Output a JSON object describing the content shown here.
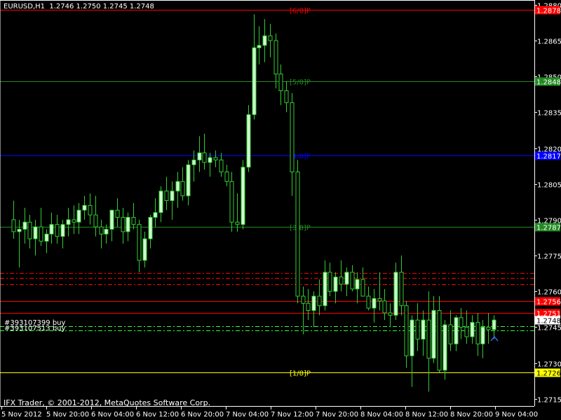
{
  "header": {
    "symbol_tf": "EURUSD,H1",
    "ohlc": "1.2746 1.2750 1.2745 1.2748"
  },
  "footer": {
    "copyright": "IFX Trader, © 2001-2012, MetaQuotes Software Corp."
  },
  "orders": [
    {
      "label": "#393107399 buy",
      "price": 1.27458
    },
    {
      "label": "#393107513 buy",
      "price": 1.27438
    }
  ],
  "colors": {
    "background": "#000000",
    "axis": "#ffffff",
    "candle_bull": "#ccffcc",
    "candle_bear": "#000000",
    "wick": "#33cc33",
    "murrey_red": "#ff0000",
    "murrey_green": "#228b22",
    "murrey_blue": "#0000ff",
    "murrey_yellow": "#ffff00",
    "dashed_red": "#ff0000",
    "dashed_green": "#33ff33"
  },
  "chart_data": {
    "type": "candlestick",
    "symbol": "EURUSD",
    "timeframe": "H1",
    "ylim": [
      1.2712,
      1.2882
    ],
    "y_ticks": [
      "1.2880",
      "1.2865",
      "1.2850",
      "1.2835",
      "1.2820",
      "1.2805",
      "1.2790",
      "1.2775",
      "1.2760",
      "1.2745",
      "1.2730",
      "1.2715"
    ],
    "x_ticks": [
      "5 Nov 2012",
      "5 Nov 20:00",
      "6 Nov 04:00",
      "6 Nov 12:00",
      "6 Nov 20:00",
      "7 Nov 04:00",
      "7 Nov 12:00",
      "7 Nov 20:00",
      "8 Nov 04:00",
      "8 Nov 12:00",
      "8 Nov 20:00",
      "9 Nov 04:00"
    ],
    "current_price": "1.2748",
    "levels": [
      {
        "label": "[6/8]P",
        "price": 1.2878,
        "tag": "1.2878",
        "color": "murrey_red",
        "kind": "line"
      },
      {
        "label": "[5/8]P",
        "price": 1.2848,
        "tag": "1.2848",
        "color": "murrey_green",
        "kind": "line"
      },
      {
        "label": "[4/8]P",
        "price": 1.2817,
        "tag": "1.2817",
        "color": "murrey_blue",
        "kind": "line"
      },
      {
        "label": "[3/8]P",
        "price": 1.2787,
        "tag": "1.2787",
        "color": "murrey_green",
        "kind": "line"
      },
      {
        "label": "",
        "price": 1.2756,
        "tag": "1.2756",
        "color": "murrey_red",
        "kind": "line"
      },
      {
        "label": "",
        "price": 1.2751,
        "tag": "1.2751",
        "color": "murrey_red",
        "kind": "line"
      },
      {
        "label": "[1/8]P",
        "price": 1.2726,
        "tag": "1.2726",
        "color": "murrey_yellow",
        "kind": "line"
      }
    ],
    "dashed_levels": [
      {
        "price": 1.27678,
        "color": "dashed_red"
      },
      {
        "price": 1.27655,
        "color": "dashed_red"
      },
      {
        "price": 1.2763,
        "color": "dashed_red"
      },
      {
        "price": 1.27455,
        "color": "dashed_green"
      },
      {
        "price": 1.27438,
        "color": "dashed_green"
      }
    ],
    "candles": [
      [
        1.279,
        1.2798,
        1.2782,
        1.2785
      ],
      [
        1.2785,
        1.279,
        1.277,
        1.2786
      ],
      [
        1.2786,
        1.2795,
        1.278,
        1.2789
      ],
      [
        1.2789,
        1.2792,
        1.2778,
        1.2782
      ],
      [
        1.2782,
        1.279,
        1.2775,
        1.2787
      ],
      [
        1.2787,
        1.2795,
        1.2779,
        1.2781
      ],
      [
        1.2781,
        1.2786,
        1.2776,
        1.2784
      ],
      [
        1.2784,
        1.2793,
        1.278,
        1.2788
      ],
      [
        1.2788,
        1.2792,
        1.278,
        1.2783
      ],
      [
        1.2783,
        1.279,
        1.2778,
        1.2788
      ],
      [
        1.2788,
        1.2795,
        1.2783,
        1.279
      ],
      [
        1.279,
        1.2796,
        1.2784,
        1.2789
      ],
      [
        1.2789,
        1.2797,
        1.2784,
        1.2794
      ],
      [
        1.2794,
        1.28,
        1.279,
        1.2796
      ],
      [
        1.2796,
        1.2801,
        1.2788,
        1.2792
      ],
      [
        1.2792,
        1.28,
        1.2783,
        1.2787
      ],
      [
        1.2787,
        1.279,
        1.2778,
        1.2784
      ],
      [
        1.2784,
        1.2788,
        1.278,
        1.2786
      ],
      [
        1.2786,
        1.2794,
        1.2781,
        1.2794
      ],
      [
        1.2794,
        1.2799,
        1.2787,
        1.2791
      ],
      [
        1.2791,
        1.2795,
        1.278,
        1.2785
      ],
      [
        1.2785,
        1.2793,
        1.2781,
        1.2791
      ],
      [
        1.2791,
        1.2797,
        1.2786,
        1.2788
      ],
      [
        1.2788,
        1.279,
        1.2768,
        1.2773
      ],
      [
        1.2773,
        1.2785,
        1.277,
        1.2782
      ],
      [
        1.2782,
        1.2792,
        1.2778,
        1.2791
      ],
      [
        1.2791,
        1.2799,
        1.2787,
        1.2793
      ],
      [
        1.2793,
        1.2804,
        1.2789,
        1.2802
      ],
      [
        1.2802,
        1.2808,
        1.2794,
        1.2798
      ],
      [
        1.2798,
        1.2806,
        1.279,
        1.2802
      ],
      [
        1.2802,
        1.281,
        1.2795,
        1.2806
      ],
      [
        1.2806,
        1.2812,
        1.2798,
        1.28
      ],
      [
        1.28,
        1.2815,
        1.2796,
        1.2813
      ],
      [
        1.2813,
        1.2819,
        1.2806,
        1.2815
      ],
      [
        1.2815,
        1.2825,
        1.281,
        1.2818
      ],
      [
        1.2818,
        1.2826,
        1.2811,
        1.2814
      ],
      [
        1.2814,
        1.2818,
        1.2808,
        1.2816
      ],
      [
        1.2816,
        1.2819,
        1.2812,
        1.2815
      ],
      [
        1.2815,
        1.2818,
        1.2808,
        1.281
      ],
      [
        1.281,
        1.2813,
        1.2804,
        1.2806
      ],
      [
        1.2806,
        1.281,
        1.2785,
        1.2789
      ],
      [
        1.2789,
        1.2801,
        1.2785,
        1.2788
      ],
      [
        1.2788,
        1.2815,
        1.2786,
        1.2812
      ],
      [
        1.2812,
        1.2838,
        1.281,
        1.2834
      ],
      [
        1.2834,
        1.2876,
        1.2832,
        1.2862
      ],
      [
        1.2862,
        1.2871,
        1.2855,
        1.2863
      ],
      [
        1.2863,
        1.2874,
        1.2856,
        1.2867
      ],
      [
        1.2867,
        1.2872,
        1.2858,
        1.2865
      ],
      [
        1.2865,
        1.2868,
        1.2845,
        1.2851
      ],
      [
        1.2851,
        1.2855,
        1.2838,
        1.2844
      ],
      [
        1.2844,
        1.2848,
        1.2835,
        1.2839
      ],
      [
        1.2839,
        1.2843,
        1.28,
        1.281
      ],
      [
        1.281,
        1.2815,
        1.2755,
        1.2758
      ],
      [
        1.2758,
        1.2762,
        1.2742,
        1.2755
      ],
      [
        1.2755,
        1.2761,
        1.2748,
        1.2752
      ],
      [
        1.2752,
        1.276,
        1.2745,
        1.2758
      ],
      [
        1.2758,
        1.2765,
        1.275,
        1.2754
      ],
      [
        1.2754,
        1.2773,
        1.2752,
        1.2768
      ],
      [
        1.2768,
        1.2772,
        1.2758,
        1.276
      ],
      [
        1.276,
        1.2768,
        1.2755,
        1.2766
      ],
      [
        1.2766,
        1.2773,
        1.276,
        1.2763
      ],
      [
        1.2763,
        1.277,
        1.2758,
        1.2768
      ],
      [
        1.2768,
        1.2771,
        1.276,
        1.2761
      ],
      [
        1.2761,
        1.2768,
        1.2755,
        1.2765
      ],
      [
        1.2765,
        1.277,
        1.2758,
        1.2758
      ],
      [
        1.2758,
        1.2762,
        1.2752,
        1.2753
      ],
      [
        1.2753,
        1.2761,
        1.2747,
        1.2757
      ],
      [
        1.2757,
        1.2768,
        1.2752,
        1.2756
      ],
      [
        1.2756,
        1.2761,
        1.2748,
        1.2751
      ],
      [
        1.2751,
        1.2755,
        1.2745,
        1.275
      ],
      [
        1.275,
        1.2772,
        1.2748,
        1.2768
      ],
      [
        1.2768,
        1.2775,
        1.275,
        1.2754
      ],
      [
        1.2754,
        1.2756,
        1.2728,
        1.2733
      ],
      [
        1.2733,
        1.275,
        1.272,
        1.2748
      ],
      [
        1.2748,
        1.2755,
        1.2735,
        1.274
      ],
      [
        1.274,
        1.2752,
        1.2733,
        1.2748
      ],
      [
        1.2748,
        1.276,
        1.2718,
        1.2732
      ],
      [
        1.2732,
        1.2758,
        1.273,
        1.2752
      ],
      [
        1.2752,
        1.2758,
        1.2726,
        1.2727
      ],
      [
        1.2727,
        1.2748,
        1.2723,
        1.2746
      ],
      [
        1.2746,
        1.2752,
        1.2735,
        1.2738
      ],
      [
        1.2738,
        1.275,
        1.2735,
        1.2749
      ],
      [
        1.2749,
        1.2753,
        1.274,
        1.2745
      ],
      [
        1.2745,
        1.2752,
        1.2738,
        1.2741
      ],
      [
        1.2741,
        1.275,
        1.2738,
        1.2747
      ],
      [
        1.2747,
        1.2751,
        1.2733,
        1.2738
      ],
      [
        1.2738,
        1.2748,
        1.2732,
        1.2745
      ],
      [
        1.2745,
        1.2751,
        1.2738,
        1.2744
      ],
      [
        1.2744,
        1.275,
        1.274,
        1.2748
      ]
    ]
  }
}
